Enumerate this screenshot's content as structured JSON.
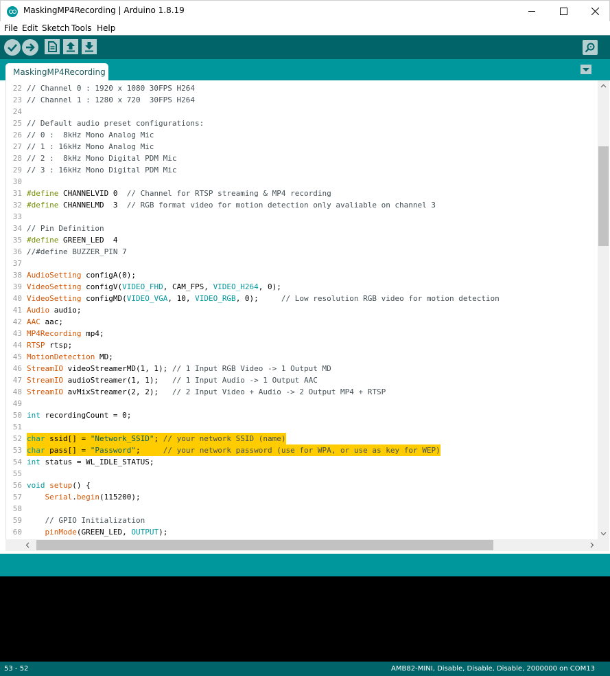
{
  "window": {
    "title": "MaskingMP4Recording | Arduino 1.8.19",
    "minimize_icon": "minimize-icon",
    "maximize_icon": "maximize-icon",
    "close_icon": "close-icon"
  },
  "menu": {
    "items": [
      "File",
      "Edit",
      "Sketch",
      "Tools",
      "Help"
    ]
  },
  "toolbar": {
    "buttons": [
      "verify-icon",
      "upload-icon",
      "new-icon",
      "open-icon",
      "save-icon"
    ],
    "serial_monitor_icon": "magnifier-icon"
  },
  "tabs": [
    {
      "label": "MaskingMP4Recording",
      "active": true
    }
  ],
  "editor": {
    "lines": [
      {
        "n": "22",
        "text": "// Channel 0 : 1920 x 1080 30FPS H264"
      },
      {
        "n": "23",
        "text": "// Channel 1 : 1280 x 720  30FPS H264"
      },
      {
        "n": "24",
        "text": ""
      },
      {
        "n": "25",
        "text": "// Default audio preset configurations:"
      },
      {
        "n": "26",
        "text": "// 0 :  8kHz Mono Analog Mic"
      },
      {
        "n": "27",
        "text": "// 1 : 16kHz Mono Analog Mic"
      },
      {
        "n": "28",
        "text": "// 2 :  8kHz Mono Digital PDM Mic"
      },
      {
        "n": "29",
        "text": "// 3 : 16kHz Mono Digital PDM Mic"
      },
      {
        "n": "30",
        "text": ""
      },
      {
        "n": "31",
        "text": "#define CHANNELVID 0  // Channel for RTSP streaming & MP4 recording"
      },
      {
        "n": "32",
        "text": "#define CHANNELMD  3  // RGB format video for motion detection only avaliable on channel 3"
      },
      {
        "n": "33",
        "text": ""
      },
      {
        "n": "34",
        "text": "// Pin Definition"
      },
      {
        "n": "35",
        "text": "#define GREEN_LED  4"
      },
      {
        "n": "36",
        "text": "//#define BUZZER_PIN 7"
      },
      {
        "n": "37",
        "text": ""
      },
      {
        "n": "38",
        "text": "AudioSetting configA(0);"
      },
      {
        "n": "39",
        "text": "VideoSetting configV(VIDEO_FHD, CAM_FPS, VIDEO_H264, 0);"
      },
      {
        "n": "40",
        "text": "VideoSetting configMD(VIDEO_VGA, 10, VIDEO_RGB, 0);     // Low resolution RGB video for motion detection"
      },
      {
        "n": "41",
        "text": "Audio audio;"
      },
      {
        "n": "42",
        "text": "AAC aac;"
      },
      {
        "n": "43",
        "text": "MP4Recording mp4;"
      },
      {
        "n": "44",
        "text": "RTSP rtsp;"
      },
      {
        "n": "45",
        "text": "MotionDetection MD;"
      },
      {
        "n": "46",
        "text": "StreamIO videoStreamerMD(1, 1); // 1 Input RGB Video -> 1 Output MD"
      },
      {
        "n": "47",
        "text": "StreamIO audioStreamer(1, 1);   // 1 Input Audio -> 1 Output AAC"
      },
      {
        "n": "48",
        "text": "StreamIO avMixStreamer(2, 2);   // 2 Input Video + Audio -> 2 Output MP4 + RTSP"
      },
      {
        "n": "49",
        "text": ""
      },
      {
        "n": "50",
        "text": "int recordingCount = 0;"
      },
      {
        "n": "51",
        "text": ""
      },
      {
        "n": "52",
        "text": "char ssid[] = \"Network_SSID\"; // your network SSID (name)"
      },
      {
        "n": "53",
        "text": "char pass[] = \"Password\";     // your network password (use for WPA, or use as key for WEP)"
      },
      {
        "n": "54",
        "text": "int status = WL_IDLE_STATUS;"
      },
      {
        "n": "55",
        "text": ""
      },
      {
        "n": "56",
        "text": "void setup() {"
      },
      {
        "n": "57",
        "text": "    Serial.begin(115200);"
      },
      {
        "n": "58",
        "text": ""
      },
      {
        "n": "59",
        "text": "    // GPIO Initialization"
      },
      {
        "n": "60",
        "text": "    pinMode(GREEN_LED, OUTPUT);"
      }
    ],
    "highlighted_lines": [
      "52",
      "53"
    ],
    "highlight_color": "#ffcc00"
  },
  "status": {
    "cursor": "53 - 52",
    "board": "AMB82-MINI, Disable, Disable, Disable, 2000000 on COM13"
  },
  "colors": {
    "toolbar": "#006468",
    "tabstrip": "#00979c",
    "console": "#000000"
  }
}
